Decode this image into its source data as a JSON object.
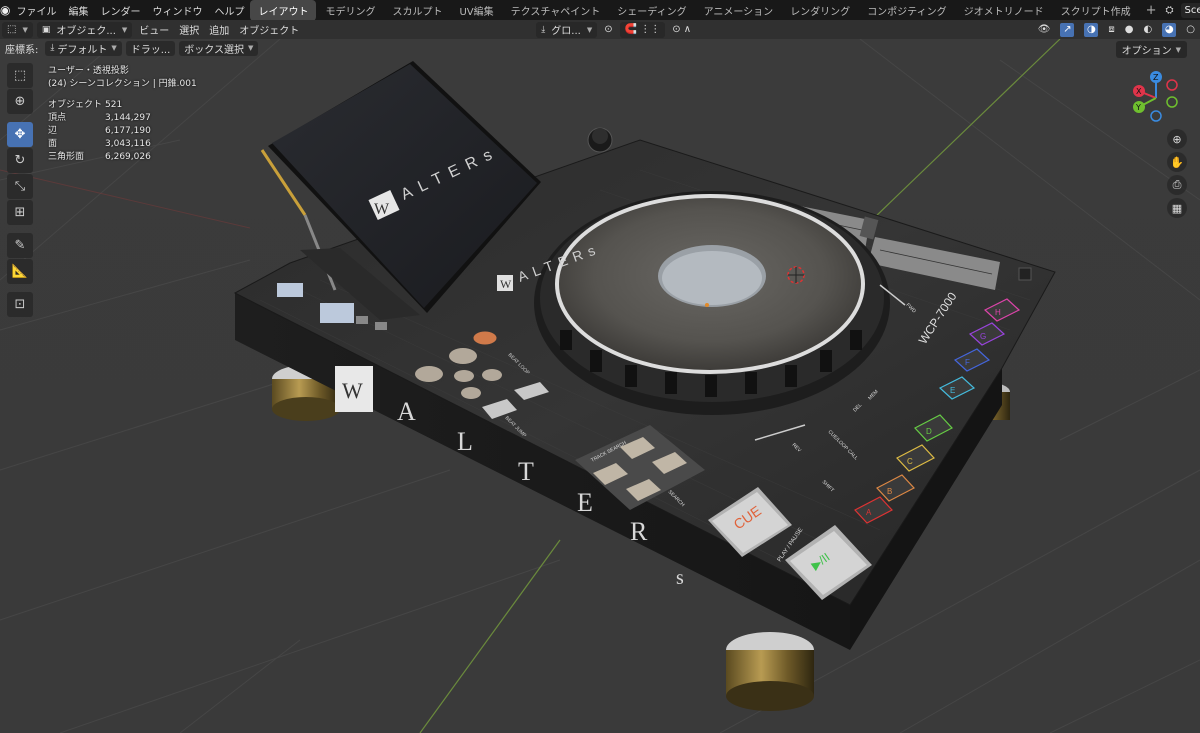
{
  "topbar": {
    "menus": [
      "ファイル",
      "編集",
      "レンダー",
      "ウィンドウ",
      "ヘルプ"
    ],
    "workspaces": [
      "レイアウト",
      "モデリング",
      "スカルプト",
      "UV編集",
      "テクスチャペイント",
      "シェーディング",
      "アニメーション",
      "レンダリング",
      "コンポジティング",
      "ジオメトリノード",
      "スクリプト作成"
    ],
    "active_workspace": "レイアウト",
    "add_tab": "+",
    "scene": "Sce"
  },
  "header": {
    "mode": "オブジェク...",
    "menus": [
      "ビュー",
      "選択",
      "追加",
      "オブジェクト"
    ],
    "transform_orientation": "グロ...",
    "options": "オプション"
  },
  "header2": {
    "coord_label": "座標系:",
    "coord_value": "デフォルト",
    "drag_label": "ドラッ...",
    "select_mode": "ボックス選択"
  },
  "overlay": {
    "view_name": "ユーザー・透視投影",
    "collection": "(24) シーンコレクション | 円錐.001",
    "stats": [
      {
        "label": "オブジェクト",
        "value": "521"
      },
      {
        "label": "頂点",
        "value": "3,144,297"
      },
      {
        "label": "辺",
        "value": "6,177,190"
      },
      {
        "label": "面",
        "value": "3,043,116"
      },
      {
        "label": "三角形面",
        "value": "6,269,026"
      }
    ]
  },
  "gizmo": {
    "x": "X",
    "y": "Y",
    "z": "Z"
  },
  "model": {
    "brand": "ALTERs",
    "brand_letters": [
      "A",
      "L",
      "T",
      "E",
      "R",
      "s"
    ],
    "logo_letter": "W",
    "screen_brand": "ALTERs",
    "model_name": "WCP-7000",
    "cue": "CUE",
    "play_pause_label": "PLAY / PAUSE",
    "play_symbol": "▶/II",
    "track_search": "TRACK SEARCH",
    "search": "SEARCH",
    "hot_cues": [
      "A",
      "B",
      "C",
      "D",
      "E",
      "F",
      "G",
      "H"
    ],
    "shift": "SHIFT",
    "cue_loop": "CUE/LOOP CALL",
    "del": "DEL",
    "mem": "MEM",
    "rev": "REV",
    "fwd": "FWD",
    "beat_jump": "BEAT JUMP",
    "beat_loop": "BEAT LOOP"
  },
  "colors": {
    "accent": "#4772b3",
    "cue_text": "#e0623a",
    "play": "#3fc24a",
    "axis_x": "#e0344a",
    "axis_y": "#6fbf2f",
    "axis_z": "#3a8be0"
  }
}
